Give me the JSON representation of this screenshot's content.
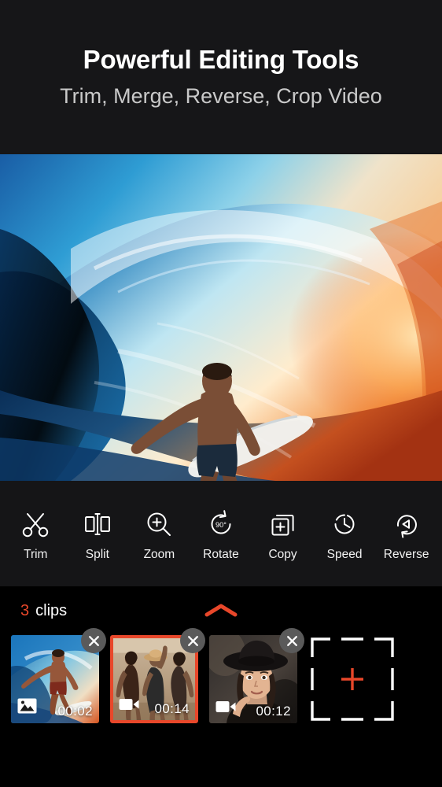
{
  "header": {
    "title": "Powerful Editing Tools",
    "subtitle": "Trim, Merge, Reverse, Crop Video"
  },
  "preview": {
    "alt": "Surfer riding inside a large blue ocean wave barrel at sunset"
  },
  "toolbar": {
    "items": [
      {
        "label": "Trim",
        "icon": "scissors-icon"
      },
      {
        "label": "Split",
        "icon": "split-icon"
      },
      {
        "label": "Zoom",
        "icon": "magnifier-plus-icon"
      },
      {
        "label": "Rotate",
        "icon": "rotate-90-icon",
        "badge": "90°"
      },
      {
        "label": "Copy",
        "icon": "copy-plus-icon"
      },
      {
        "label": "Speed",
        "icon": "stopwatch-icon"
      },
      {
        "label": "Reverse",
        "icon": "reverse-play-icon"
      }
    ]
  },
  "clips": {
    "count": "3",
    "count_word": "clips",
    "collapse_icon": "chevron-up-icon",
    "items": [
      {
        "duration": "00:02",
        "type_icon": "photo-icon",
        "selected": false,
        "alt": "Surfer on a wave"
      },
      {
        "duration": "00:14",
        "type_icon": "video-icon",
        "selected": true,
        "alt": "Three women dancing on the beach"
      },
      {
        "duration": "00:12",
        "type_icon": "video-icon",
        "selected": false,
        "alt": "Woman wearing a black hat"
      }
    ],
    "add_label": "add-clip",
    "add_icon": "plus-icon",
    "close_icon": "close-icon"
  },
  "colors": {
    "accent": "#e8472a",
    "header_bg": "#161618",
    "toolbar_bg": "#151517",
    "page_bg": "#000000",
    "text_primary": "#ffffff",
    "text_secondary": "#c9c9c9"
  }
}
